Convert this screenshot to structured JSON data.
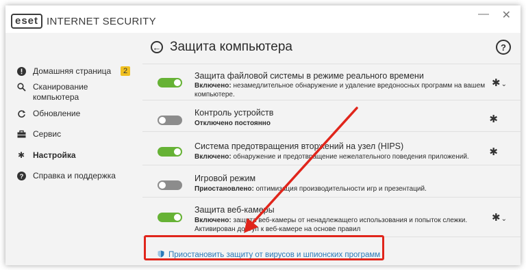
{
  "app": {
    "logo_text": "eset",
    "product_name": "INTERNET SECURITY",
    "minimize_symbol": "—",
    "close_symbol": "✕"
  },
  "sidebar": {
    "items": [
      {
        "label": "Домашняя страница",
        "icon": "alert-icon",
        "badge": "2"
      },
      {
        "label": "Сканирование компьютера",
        "icon": "search-icon"
      },
      {
        "label": "Обновление",
        "icon": "refresh-icon"
      },
      {
        "label": "Сервис",
        "icon": "briefcase-icon"
      },
      {
        "label": "Настройка",
        "icon": "gear-icon",
        "active": true
      },
      {
        "label": "Справка и поддержка",
        "icon": "help-icon"
      }
    ]
  },
  "main": {
    "title": "Защита компьютера",
    "help_symbol": "?",
    "rows": [
      {
        "title": "Защита файловой системы в режиме реального времени",
        "status": "Включено:",
        "desc": "незамедлительное обнаружение и удаление вредоносных программ на вашем компьютере.",
        "state": "on",
        "has_menu": true
      },
      {
        "title": "Контроль устройств",
        "status": "Отключено постоянно",
        "desc": "",
        "state": "off",
        "has_menu": false
      },
      {
        "title": "Система предотвращения вторжений на узел (HIPS)",
        "status": "Включено:",
        "desc": "обнаружение и предотвращение нежелательного поведения приложений.",
        "state": "on",
        "has_menu": false
      },
      {
        "title": "Игровой режим",
        "status": "Приостановлено:",
        "desc": "оптимизация производительности игр и презентаций.",
        "state": "off",
        "has_menu": false
      },
      {
        "title": "Защита веб-камеры",
        "status": "Включено:",
        "desc": "защита веб-камеры от ненадлежащего использования и попыток слежки. Активирован доступ к веб-камере на основе правил",
        "state": "on",
        "has_menu": true
      }
    ],
    "suspend_link": "Приостановить защиту от вирусов и шпионских программ"
  },
  "colors": {
    "toggle_on": "#66b235",
    "toggle_off": "#8c8c8c",
    "link": "#2a7ab8",
    "annotation": "#e0251b",
    "badge": "#f0c020"
  }
}
